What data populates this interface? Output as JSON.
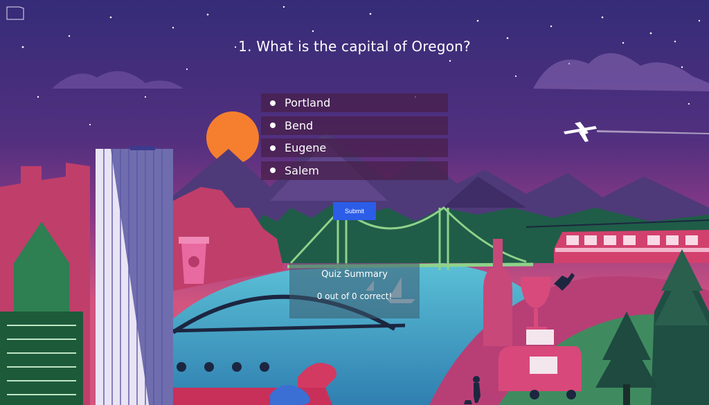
{
  "question": {
    "text": "1. What is the capital of Oregon?"
  },
  "options": [
    {
      "label": "Portland"
    },
    {
      "label": "Bend"
    },
    {
      "label": "Eugene"
    },
    {
      "label": "Salem"
    }
  ],
  "submit": {
    "label": "Submit"
  },
  "summary": {
    "title": "Quiz Summary",
    "score": "0 out of 0 correct!"
  },
  "colors": {
    "sky_top": "#3b2c7a",
    "sky_bottom": "#c8508a",
    "sun": "#f57f2f",
    "accent_button": "#2b5de8"
  }
}
